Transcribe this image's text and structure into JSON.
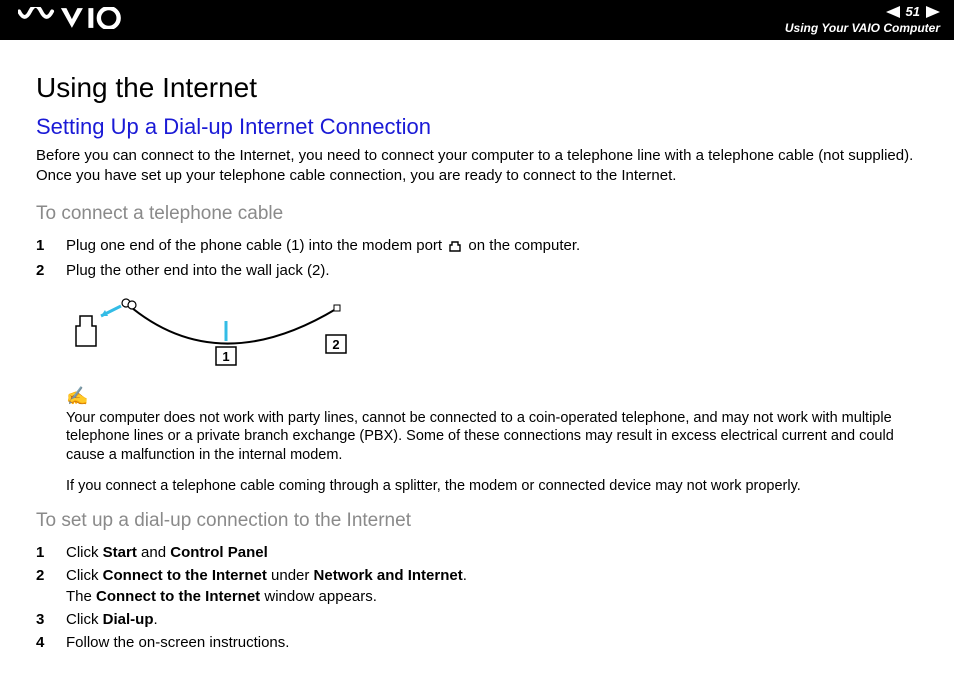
{
  "header": {
    "page_number": "51",
    "section_title": "Using Your VAIO Computer"
  },
  "title": "Using the Internet",
  "subtitle": "Setting Up a Dial-up Internet Connection",
  "intro": "Before you can connect to the Internet, you need to connect your computer to a telephone line with a telephone cable (not supplied). Once you have set up your telephone cable connection, you are ready to connect to the Internet.",
  "sec1_title": "To connect a telephone cable",
  "step1a_pre": "Plug one end of the phone cable (1) into the modem port ",
  "step1a_post": " on the computer.",
  "step1b": "Plug the other end into the wall jack (2).",
  "diagram": {
    "label1": "1",
    "label2": "2"
  },
  "note1": "Your computer does not work with party lines, cannot be connected to a coin-operated telephone, and may not work with multiple telephone lines or a private branch exchange (PBX). Some of these connections may result in excess electrical current and could cause a malfunction in the internal modem.",
  "note2": "If you connect a telephone cable coming through a splitter, the modem or connected device may not work properly.",
  "sec2_title": "To set up a dial-up connection to the Internet",
  "s2": {
    "n1": "1",
    "n2": "2",
    "n3": "3",
    "n4": "4",
    "t1_pre": "Click ",
    "t1_b1": "Start",
    "t1_mid": " and ",
    "t1_b2": "Control Panel",
    "t2_pre": "Click ",
    "t2_b1": "Connect to the Internet",
    "t2_mid": " under ",
    "t2_b2": "Network and Internet",
    "t2_end": ".",
    "t2b_pre": "The ",
    "t2b_b": "Connect to the Internet",
    "t2b_end": " window appears.",
    "t3_pre": "Click ",
    "t3_b": "Dial-up",
    "t3_end": ".",
    "t4": "Follow the on-screen instructions."
  }
}
